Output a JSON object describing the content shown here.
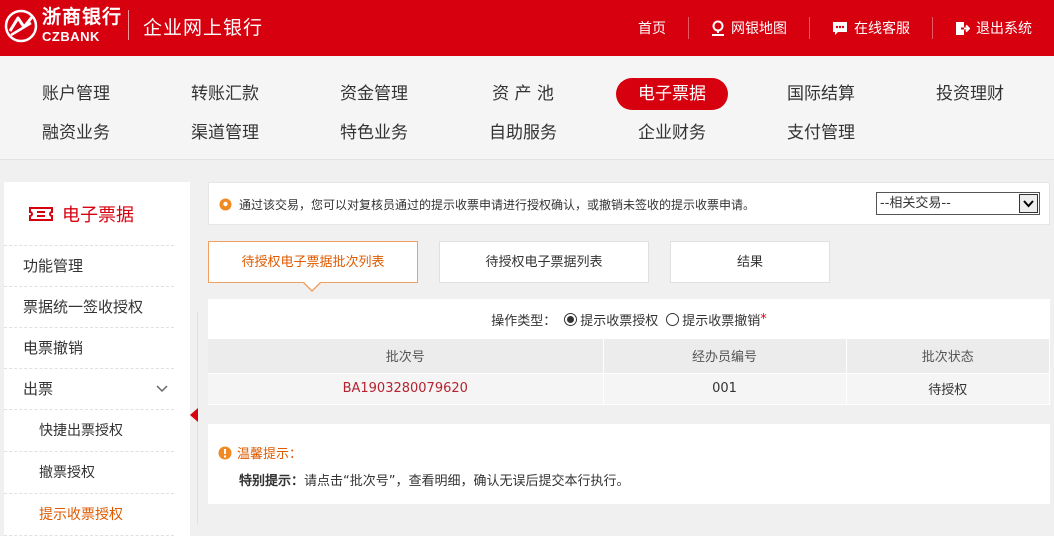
{
  "brand": {
    "name_cn": "浙商银行",
    "name_en": "CZBANK",
    "system_title": "企业网上银行"
  },
  "top_links": [
    {
      "label": "首页",
      "icon": "home"
    },
    {
      "label": "网银地图",
      "icon": "map-pin-icon"
    },
    {
      "label": "在线客服",
      "icon": "chat-icon"
    },
    {
      "label": "退出系统",
      "icon": "logout-icon"
    }
  ],
  "main_nav": {
    "row1": [
      "账户管理",
      "转账汇款",
      "资金管理",
      "资 产 池",
      "电子票据",
      "国际结算",
      "投资理财"
    ],
    "row2": [
      "融资业务",
      "渠道管理",
      "特色业务",
      "自助服务",
      "企业财务",
      "支付管理"
    ],
    "active": "电子票据"
  },
  "sidebar": {
    "title": "电子票据",
    "title_icon": "ticket-icon",
    "items": [
      "功能管理",
      "票据统一签收授权",
      "电票撤销",
      "出票"
    ],
    "subitems": [
      "快捷出票授权",
      "撤票授权",
      "提示收票授权"
    ],
    "active": "提示收票授权",
    "accent_color": "#d7000f"
  },
  "notice": {
    "text": "通过该交易，您可以对复核员通过的提示收票申请进行授权确认，或撤销未签收的提示收票申请。",
    "related_select": "--相关交易--"
  },
  "tabs": [
    "待授权电子票据批次列表",
    "待授权电子票据列表",
    "结果"
  ],
  "active_tab": "待授权电子票据批次列表",
  "operation": {
    "label": "操作类型：",
    "options": [
      "提示收票授权",
      "提示收票撤销"
    ],
    "selected": "提示收票授权",
    "required_mark": "*"
  },
  "table": {
    "headers": [
      "批次号",
      "经办员编号",
      "批次状态"
    ],
    "rows": [
      [
        "BA1903280079620",
        "001",
        "待授权"
      ]
    ]
  },
  "tips": {
    "title": "温馨提示：",
    "label": "特别提示：",
    "text": "请点击“批次号”，查看明细，确认无误后提交本行执行。"
  }
}
